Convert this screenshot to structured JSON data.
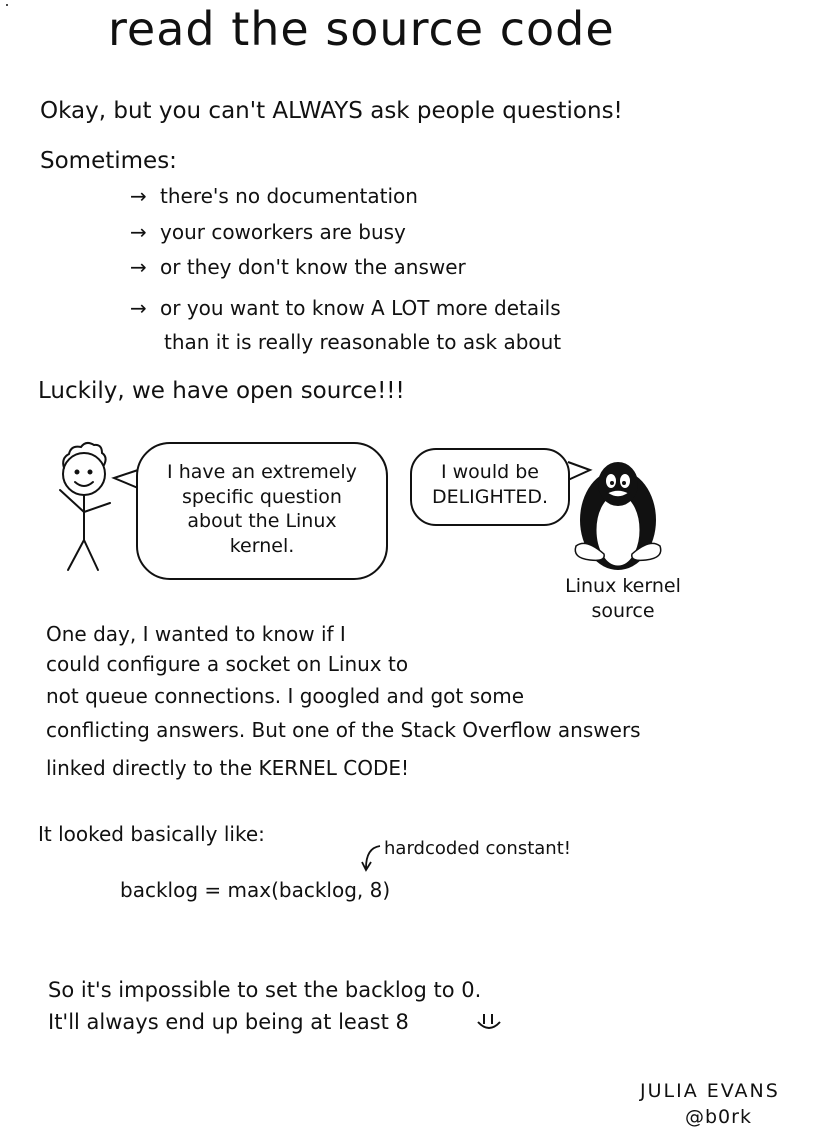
{
  "title": "read the source code",
  "intro": "Okay, but you can't ALWAYS ask people questions!",
  "sometimes_label": "Sometimes:",
  "bullets": [
    "there's no documentation",
    "your coworkers are busy",
    "or they don't know the answer",
    "or you want to know A LOT more details"
  ],
  "bullet_continuation": "than it is really reasonable to ask about",
  "luckily": "Luckily, we have open source!!!",
  "comic": {
    "person_bubble": [
      "I have an extremely",
      "specific question",
      "about the Linux",
      "kernel."
    ],
    "tux_bubble": [
      "I would be",
      "DELIGHTED."
    ],
    "tux_label": [
      "Linux kernel",
      "source"
    ]
  },
  "story_lines": [
    "One day, I wanted to know if I",
    "could configure a socket on Linux to",
    "not queue connections. I googled and got some",
    "conflicting answers. But one of the Stack Overflow answers",
    "linked directly to the KERNEL CODE!"
  ],
  "looked_like": "It looked basically like:",
  "code_line": "backlog = max(backlog, 8)",
  "annotation": "hardcoded constant!",
  "conclusion_lines": [
    "So it's impossible to set the backlog to 0.",
    "It'll always end up being at least 8"
  ],
  "signature": {
    "name": "JULIA EVANS",
    "handle": "@b0rk"
  }
}
